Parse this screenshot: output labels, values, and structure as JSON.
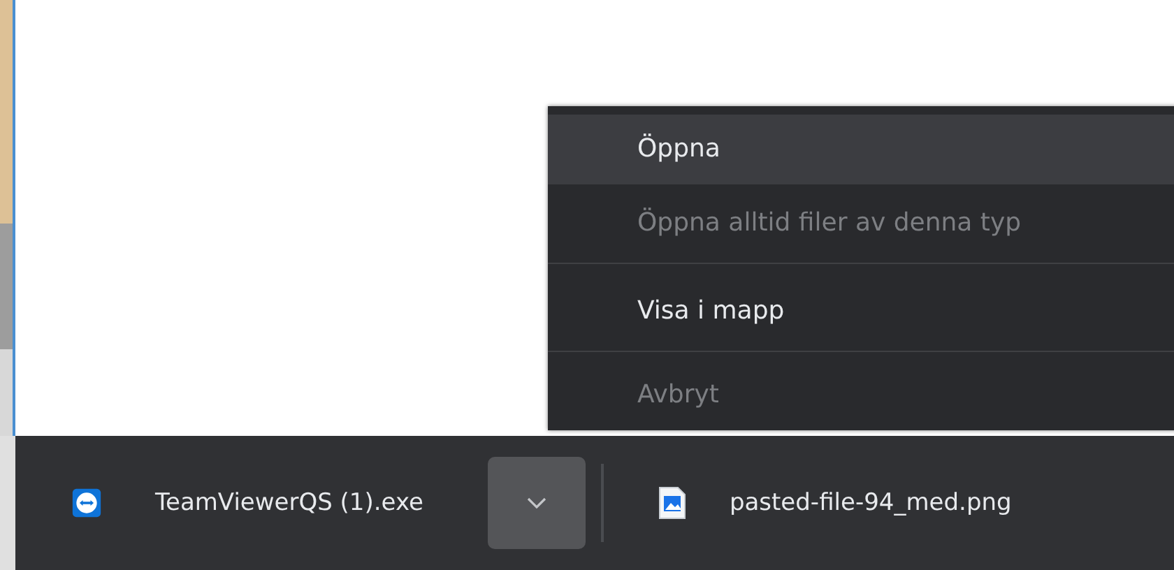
{
  "context_menu": {
    "items": [
      {
        "label": "Öppna",
        "selected": true,
        "disabled": false,
        "separator_after": false
      },
      {
        "label": "Öppna alltid filer av denna typ",
        "selected": false,
        "disabled": true,
        "separator_after": true
      },
      {
        "label": "Visa i mapp",
        "selected": false,
        "disabled": false,
        "separator_after": true
      },
      {
        "label": "Avbryt",
        "selected": false,
        "disabled": true,
        "separator_after": false
      }
    ]
  },
  "download_bar": {
    "items": [
      {
        "name": "TeamViewerQS (1).exe",
        "kind": "app",
        "menu_button": {
          "pressed": true
        }
      },
      {
        "name": "pasted-file-94_med.png",
        "kind": "image"
      }
    ]
  }
}
